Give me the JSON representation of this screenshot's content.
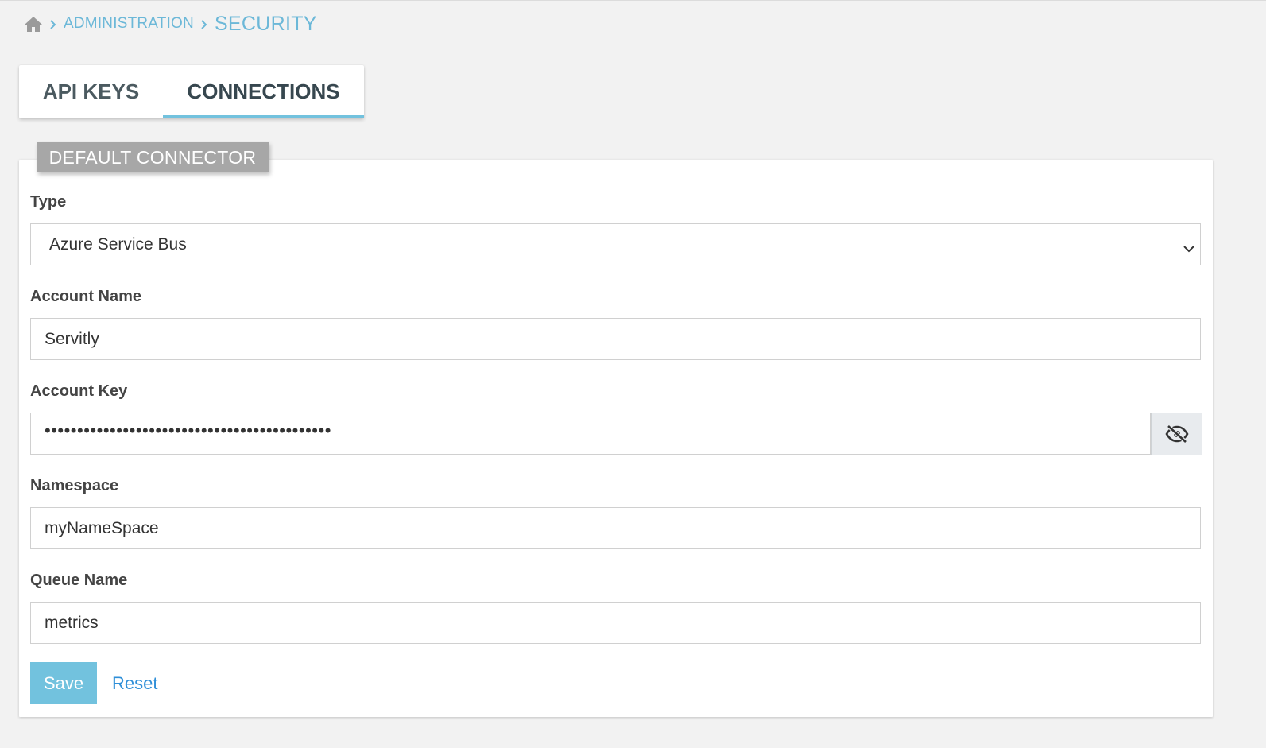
{
  "breadcrumb": {
    "home_icon": "home-icon",
    "administration": "ADMINISTRATION",
    "security": "SECURITY"
  },
  "tabs": [
    {
      "label": "API KEYS",
      "active": false
    },
    {
      "label": "CONNECTIONS",
      "active": true
    }
  ],
  "card": {
    "title": "DEFAULT CONNECTOR",
    "fields": {
      "type": {
        "label": "Type",
        "value": "Azure Service Bus"
      },
      "account_name": {
        "label": "Account Name",
        "value": "Servitly"
      },
      "account_key": {
        "label": "Account Key",
        "value": "••••••••••••••••••••••••••••••••••••••••••••",
        "toggle_icon": "eye-slash-icon"
      },
      "namespace": {
        "label": "Namespace",
        "value": "myNameSpace"
      },
      "queue_name": {
        "label": "Queue Name",
        "value": "metrics"
      }
    },
    "actions": {
      "save": "Save",
      "reset": "Reset"
    }
  },
  "colors": {
    "accent": "#72c2de",
    "link": "#2f8fd8",
    "badge": "#a7a7a7",
    "background": "#f2f2f2"
  }
}
